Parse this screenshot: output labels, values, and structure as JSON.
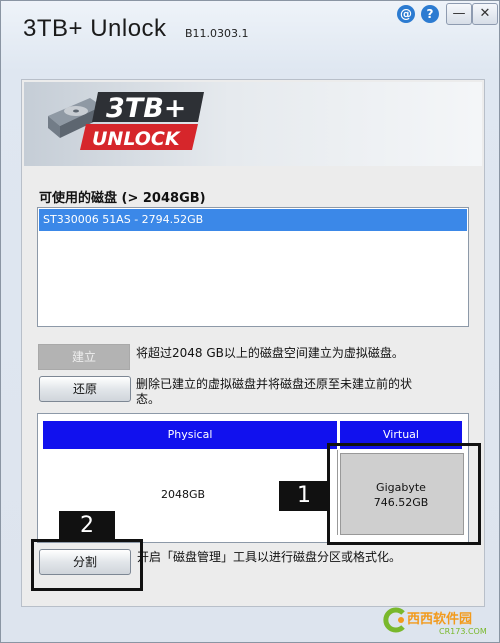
{
  "window": {
    "title": "3TB+ Unlock",
    "version": "B11.0303.1",
    "help_buttons": [
      "@",
      "?"
    ],
    "minimize": "—",
    "close": "✕"
  },
  "logo": {
    "line1": "3TB+",
    "line2": "UNLOCK"
  },
  "disks": {
    "label": "可使用的磁盘 (> 2048GB)",
    "items": [
      "ST330006 51AS - 2794.52GB"
    ]
  },
  "actions": {
    "create_label": "建立",
    "create_desc": "将超过2048 GB以上的磁盘空间建立为虚拟磁盘。",
    "restore_label": "还原",
    "restore_desc_line1": "删除已建立的虚拟磁盘并将磁盘还原至未建立前的状",
    "restore_desc_line2": "态。",
    "split_label": "分割",
    "split_desc": "开启「磁盘管理」工具以进行磁盘分区或格式化。"
  },
  "partition": {
    "physical_header": "Physical",
    "virtual_header": "Virtual",
    "physical_size": "2048GB",
    "virtual_unit": "Gigabyte",
    "virtual_size": "746.52GB"
  },
  "callouts": [
    "1",
    "2"
  ],
  "watermark": {
    "name": "西西软件园",
    "url": "CR173.COM"
  },
  "colors": {
    "header_blue": "#1111ee",
    "selection_blue": "#3b88e8",
    "logo_red": "#d6262b"
  }
}
